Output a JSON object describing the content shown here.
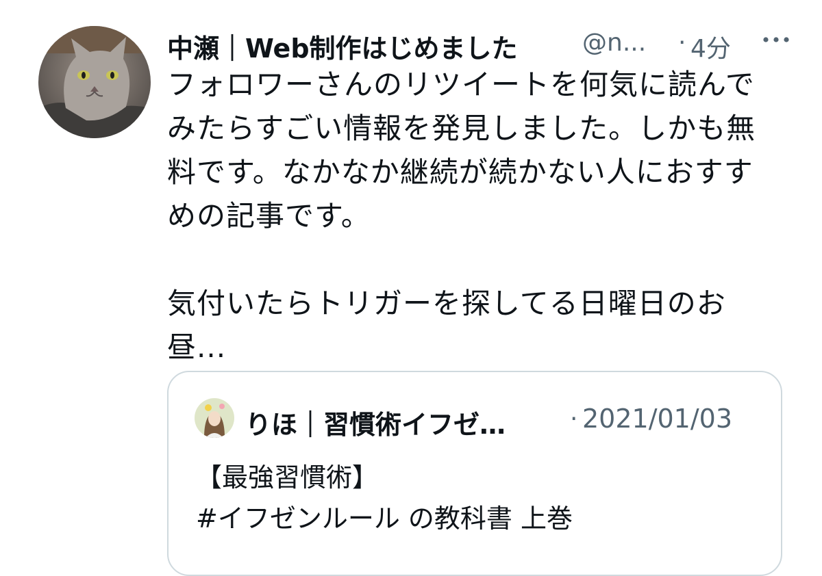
{
  "tweet": {
    "author_name": "中瀬｜Web制作はじめました",
    "author_handle": "@n...",
    "separator": "·",
    "time": "4分",
    "more_icon": "more-horizontal-icon",
    "text_lines": [
      "フォロワーさんのリツイートを何気に読んで",
      "みたらすごい情報を発見しました。しかも無",
      "料です。なかなか継続が続かない人におすす",
      "めの記事です。",
      "",
      "気付いたらトリガーを探してる日曜日のお",
      "昼..."
    ]
  },
  "quoted_tweet": {
    "author_name": "りほ｜習慣術イフゼ…",
    "separator": "·",
    "date": "2021/01/03",
    "text_lines": [
      "【最強習慣術】",
      "#イフゼンルール の教科書 上巻"
    ]
  },
  "colors": {
    "text": "#0f1419",
    "secondary": "#536471",
    "border": "#cfd9de"
  }
}
